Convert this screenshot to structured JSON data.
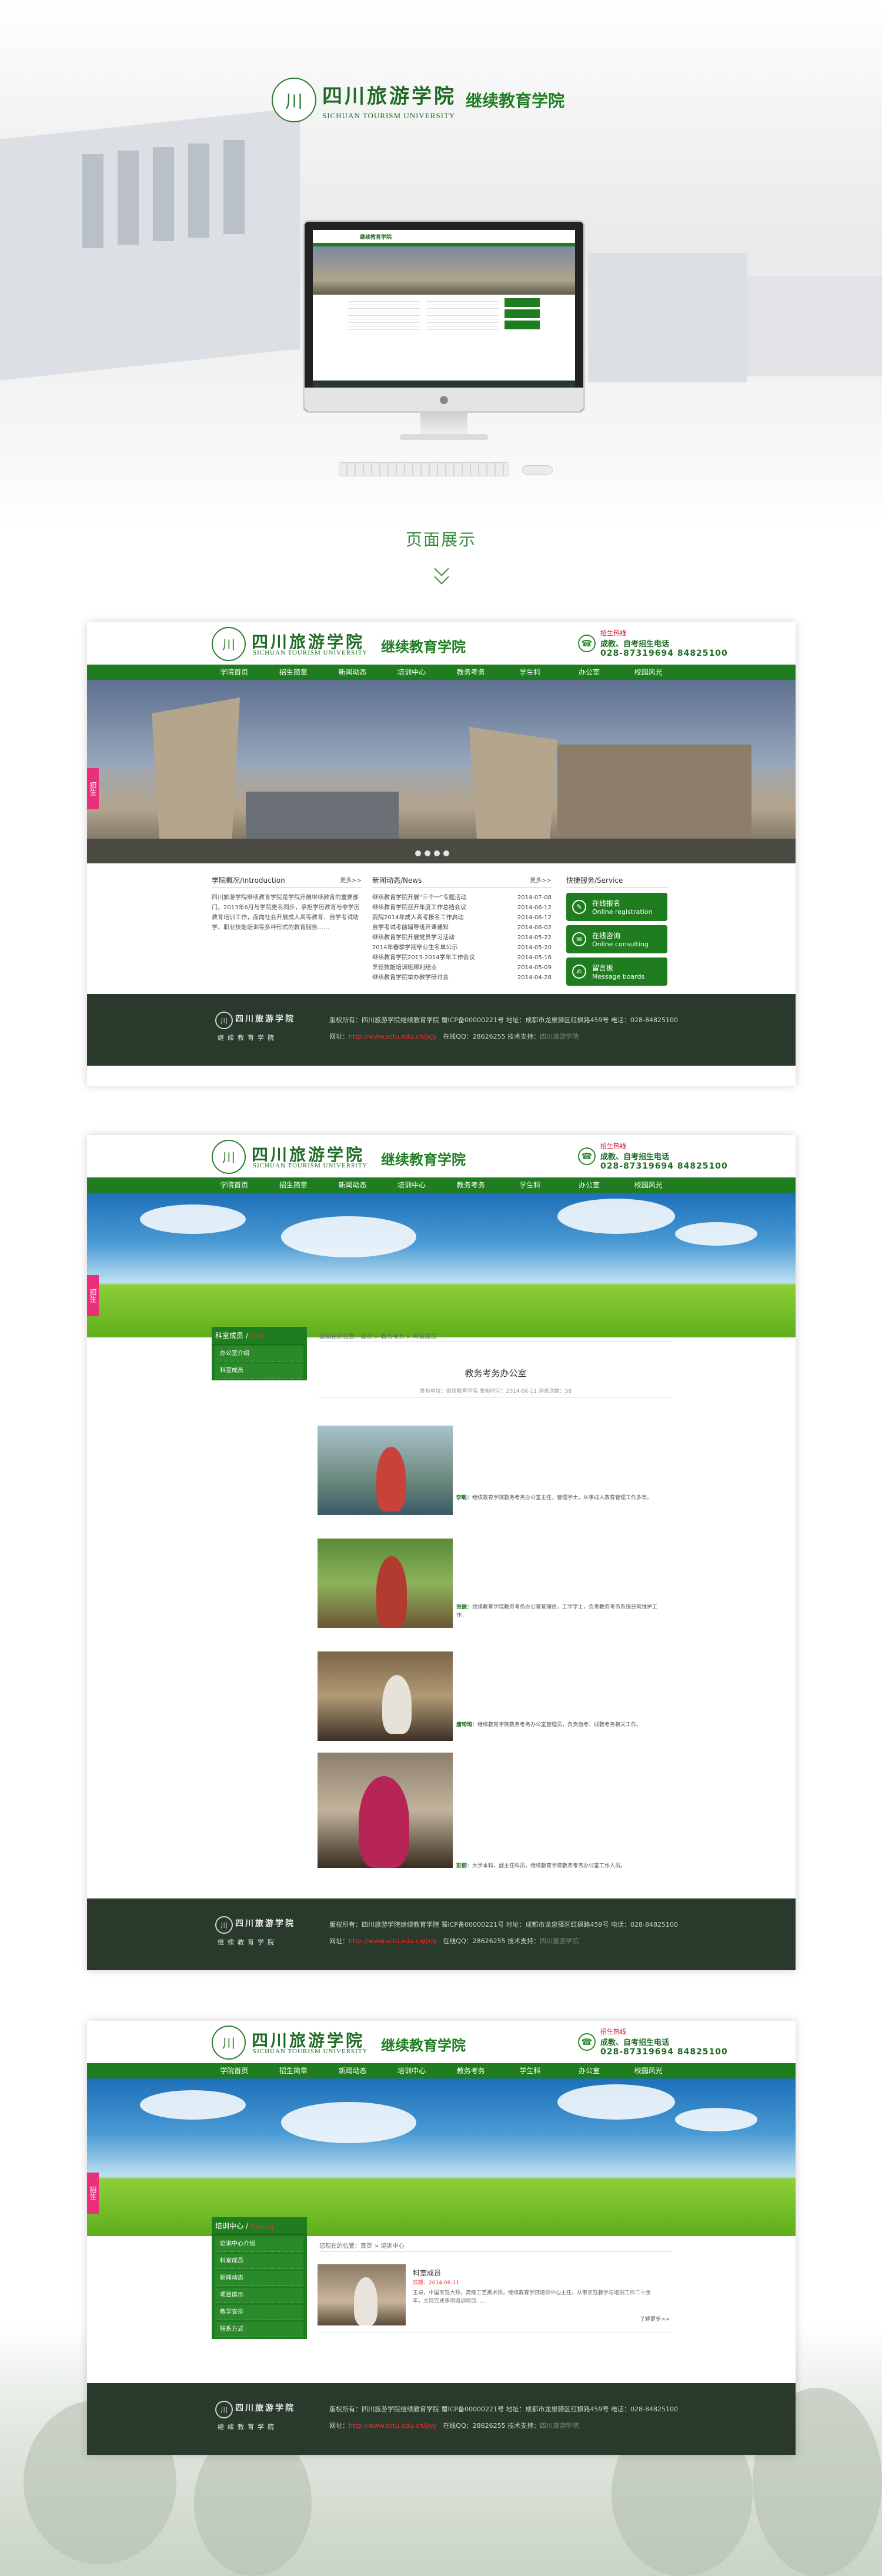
{
  "header": {
    "school_cn": "四川旅游学院",
    "school_en": "SICHUAN TOURISM UNIVERSITY",
    "dept": "继续教育学院"
  },
  "section_title": "页面展示",
  "site": {
    "hotline_label": "招生热线",
    "hotline_sub": "成教、自考招生电话",
    "hotline_number": "028-87319694  84825100",
    "nav": [
      "学院首页",
      "招生简章",
      "新闻动态",
      "培训中心",
      "教务考务",
      "学生科",
      "办公室",
      "校园风光"
    ],
    "side_tab": "招生",
    "intro_title": "学院概况/Introduction",
    "news_title": "新闻动态/News",
    "service_title": "快捷服务/Service",
    "more": "更多>>",
    "intro_text": "四川旅游学院继续教育学院是学院开展继续教育的重要部门，2013年6月与学院更名同步，承担学历教育与非学历教育培训工作，面向社会开展成人高等教育、自学考试助学、职业技能培训等多种形式的教育服务……",
    "news": [
      {
        "title": "继续教育学院开展“三个一”专题活动",
        "date": "2014-07-08"
      },
      {
        "title": "继续教育学院召开年度工作总结会议",
        "date": "2014-06-12"
      },
      {
        "title": "我院2014年成人高考报名工作启动",
        "date": "2014-06-12"
      },
      {
        "title": "自学考试考前辅导班开课通知",
        "date": "2014-06-02"
      },
      {
        "title": "继续教育学院开展党员学习活动",
        "date": "2014-05-22"
      },
      {
        "title": "2014年春季学期毕业生名单公示",
        "date": "2014-05-20"
      },
      {
        "title": "继续教育学院2013-2014学年工作会议",
        "date": "2014-05-16"
      },
      {
        "title": "烹饪技能培训班顺利结业",
        "date": "2014-05-09"
      },
      {
        "title": "继续教育学院举办教学研讨会",
        "date": "2014-04-28"
      }
    ],
    "services": [
      {
        "title": "在线报名",
        "sub": "Online registration"
      },
      {
        "title": "在线咨询",
        "sub": "Online consulting"
      },
      {
        "title": "留言板",
        "sub": "Message boards"
      }
    ],
    "footer": {
      "name": "继续教育学院",
      "line1": "版权所有：四川旅游学院继续教育学院  蜀ICP备00000221号    地址：成都市龙泉驿区红枫路459号    电话：028-84825100",
      "line2_label": "网址：",
      "url": "http://www.sctu.edu.cn/jxjy",
      "line2_rest": "在线QQ：28626255    技术支持：",
      "support": "四川旅游学院"
    }
  },
  "page2": {
    "sidebar_title": "科室成员",
    "sidebar_tag": "Staff",
    "sidebar_items": [
      "办公室介绍",
      "科室成员"
    ],
    "crumb": "您现在的位置：首页 > 教务考务 > 科室成员",
    "article_title": "教务考务办公室",
    "meta": "发布单位：继续教育学院  发布时间：2014-06-11  浏览次数：58",
    "captions": [
      {
        "name": "李敏：",
        "text": "继续教育学院教务考务办公室主任，管理学士，从事成人教育管理工作多年。"
      },
      {
        "name": "张振：",
        "text": "继续教育学院教务考务办公室管理员，工学学士，负责教务考务系统日常维护工作。"
      },
      {
        "name": "唐琦琦：",
        "text": "继续教育学院教务考务办公室管理员，负责自考、成教考务相关工作。"
      },
      {
        "name": "彭丽：",
        "text": "大学本科，副主任科员，继续教育学院教务考务办公室工作人员。"
      }
    ]
  },
  "page3": {
    "sidebar_title": "培训中心",
    "sidebar_tag": "Training",
    "sidebar_items": [
      "培训中心介绍",
      "科室成员",
      "新闻动态",
      "项目展示",
      "教学安排",
      "联系方式"
    ],
    "crumb": "您现在的位置：首页 > 培训中心",
    "item_title": "科室成员",
    "item_date": "日期：2014-06-11",
    "item_text": "王卓，中国烹饪大师，高级工艺美术师，继续教育学院培训中心主任，从事烹饪教学与培训工作二十余年，主持完成多项培训项目……",
    "read_more": "了解更多>>"
  }
}
